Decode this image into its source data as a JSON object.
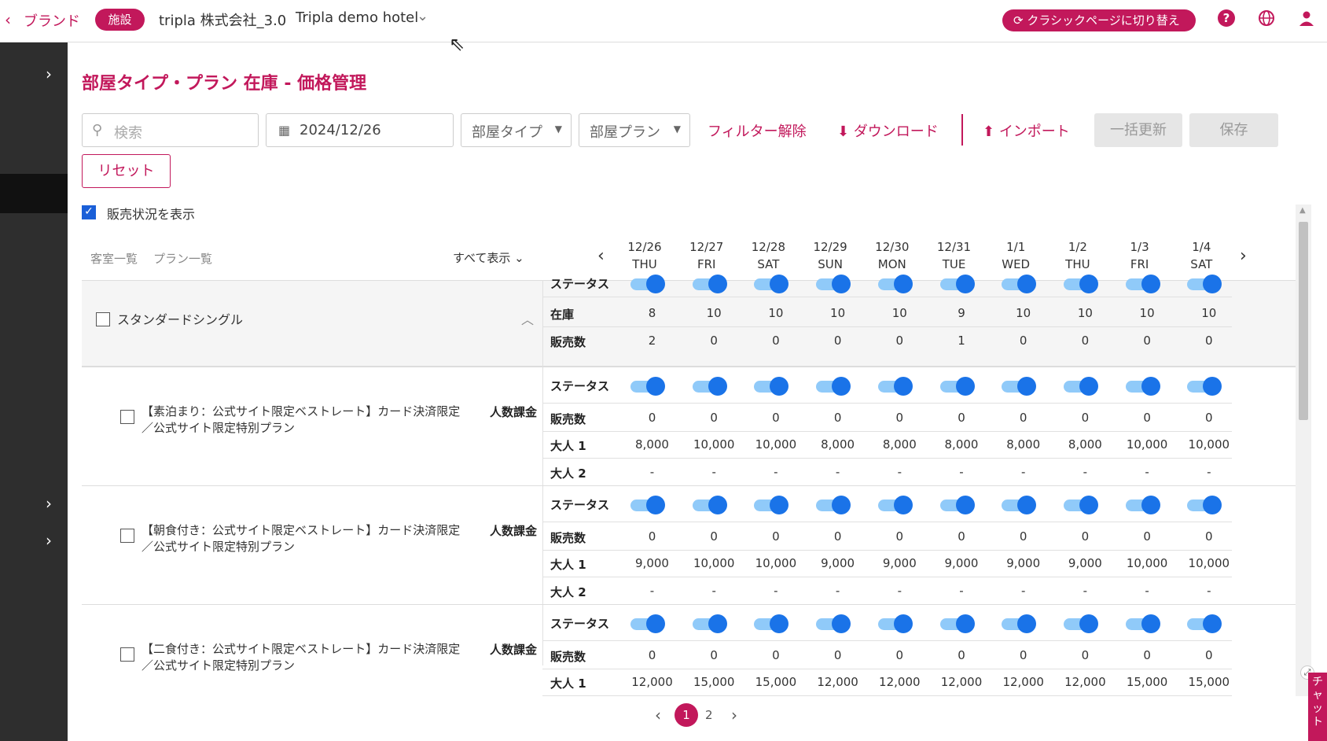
{
  "header": {
    "back_label": "ブランド",
    "facility_badge": "施設",
    "company": "tripla 株式会社_3.0",
    "hotel": "Tripla demo hotel",
    "classic_button": "クラシックページに切り替え"
  },
  "page": {
    "title": "部屋タイプ・プラン 在庫 - 価格管理"
  },
  "toolbar": {
    "search_placeholder": "検索",
    "date_value": "2024/12/26",
    "room_type_select": "部屋タイプ",
    "room_plan_select": "部屋プラン",
    "clear_filter": "フィルター解除",
    "download": "ダウンロード",
    "import": "インポート",
    "bulk_update": "一括更新",
    "save": "保存",
    "reset": "リセット"
  },
  "options": {
    "show_sales_status": "販売状況を表示",
    "show_sales_checked": true
  },
  "tabs": {
    "room_list": "客室一覧",
    "plan_list": "プラン一覧",
    "show_all": "すべて表示"
  },
  "dates": [
    {
      "date": "12/26",
      "day": "THU"
    },
    {
      "date": "12/27",
      "day": "FRI"
    },
    {
      "date": "12/28",
      "day": "SAT"
    },
    {
      "date": "12/29",
      "day": "SUN"
    },
    {
      "date": "12/30",
      "day": "MON"
    },
    {
      "date": "12/31",
      "day": "TUE"
    },
    {
      "date": "1/1",
      "day": "WED"
    },
    {
      "date": "1/2",
      "day": "THU"
    },
    {
      "date": "1/3",
      "day": "FRI"
    },
    {
      "date": "1/4",
      "day": "SAT"
    }
  ],
  "room": {
    "name": "スタンダードシングル",
    "labels": {
      "status": "ステータス",
      "stock": "在庫",
      "sold": "販売数"
    },
    "stock": [
      "8",
      "10",
      "10",
      "10",
      "10",
      "9",
      "10",
      "10",
      "10",
      "10"
    ],
    "sold": [
      "2",
      "0",
      "0",
      "0",
      "0",
      "1",
      "0",
      "0",
      "0",
      "0"
    ]
  },
  "plan_labels": {
    "status": "ステータス",
    "sold": "販売数",
    "adult1": "大人 1",
    "adult2": "大人 2",
    "pricing": "人数課金"
  },
  "plans": [
    {
      "name_line1": "【素泊まり：公式サイト限定ベストレート】カード決済限定",
      "name_line2": "／公式サイト限定特別プラン",
      "sold": [
        "0",
        "0",
        "0",
        "0",
        "0",
        "0",
        "0",
        "0",
        "0",
        "0"
      ],
      "adult1": [
        "8,000",
        "10,000",
        "10,000",
        "8,000",
        "8,000",
        "8,000",
        "8,000",
        "8,000",
        "10,000",
        "10,000"
      ],
      "adult2": [
        "-",
        "-",
        "-",
        "-",
        "-",
        "-",
        "-",
        "-",
        "-",
        "-"
      ]
    },
    {
      "name_line1": "【朝食付き：公式サイト限定ベストレート】カード決済限定",
      "name_line2": "／公式サイト限定特別プラン",
      "sold": [
        "0",
        "0",
        "0",
        "0",
        "0",
        "0",
        "0",
        "0",
        "0",
        "0"
      ],
      "adult1": [
        "9,000",
        "10,000",
        "10,000",
        "9,000",
        "9,000",
        "9,000",
        "9,000",
        "9,000",
        "10,000",
        "10,000"
      ],
      "adult2": [
        "-",
        "-",
        "-",
        "-",
        "-",
        "-",
        "-",
        "-",
        "-",
        "-"
      ]
    },
    {
      "name_line1": "【二食付き：公式サイト限定ベストレート】カード決済限定",
      "name_line2": "／公式サイト限定特別プラン",
      "sold": [
        "0",
        "0",
        "0",
        "0",
        "0",
        "0",
        "0",
        "0",
        "0",
        "0"
      ],
      "adult1": [
        "12,000",
        "15,000",
        "15,000",
        "12,000",
        "12,000",
        "12,000",
        "12,000",
        "12,000",
        "15,000",
        "15,000"
      ]
    }
  ],
  "pagination": {
    "current": "1",
    "next": "2"
  },
  "chat": {
    "label": "チャット"
  }
}
